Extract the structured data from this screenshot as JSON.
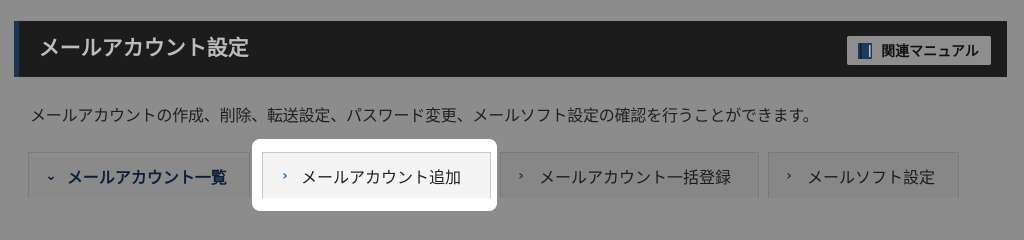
{
  "header": {
    "title": "メールアカウント設定",
    "manual_button_label": "関連マニュアル"
  },
  "description": "メールアカウントの作成、削除、転送設定、パスワード変更、メールソフト設定の確認を行うことができます。",
  "tabs": [
    {
      "label": "メールアカウント一覧",
      "icon": "chevron-down-icon",
      "state": "current"
    },
    {
      "label": "メールアカウント追加",
      "icon": "chevron-right-icon",
      "state": "highlighted"
    },
    {
      "label": "メールアカウント一括登録",
      "icon": "chevron-right-icon",
      "state": "normal"
    },
    {
      "label": "メールソフト設定",
      "icon": "chevron-right-icon",
      "state": "normal"
    }
  ],
  "colors": {
    "overlay_bg": "#8c8c8c",
    "header_bg": "#1c1c1c",
    "accent_blue": "#2e6fb5",
    "highlight_bg": "#ffffff"
  }
}
